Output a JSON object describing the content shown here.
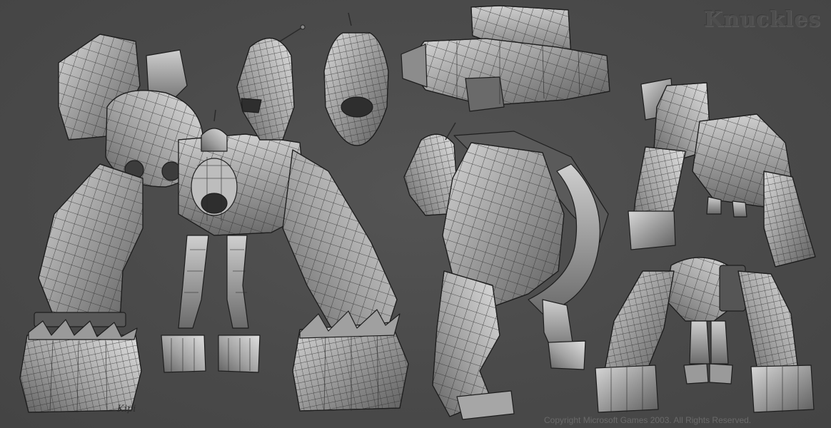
{
  "title": "Knuckles",
  "signature": "Kipi",
  "copyright": "Copyright Microsoft Games 2003. All Rights Reserved."
}
